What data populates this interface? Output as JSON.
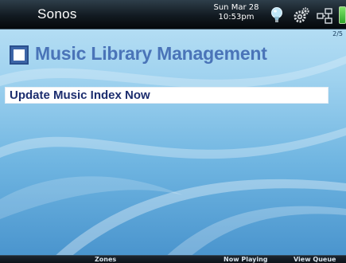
{
  "status_bar": {
    "brand": "Sonos",
    "date": "Sun Mar 28",
    "time": "10:53pm"
  },
  "page_indicator": "2/5",
  "header": {
    "title": "Music Library Management",
    "icon": "checkbox-icon"
  },
  "menu": {
    "items": [
      {
        "label": "Update Music Index Now"
      }
    ]
  },
  "softkeys": {
    "left": "Zones",
    "center": "Now Playing",
    "right": "View Queue"
  },
  "status_icons": [
    "lightbulb-icon",
    "gear-icon",
    "network-icon",
    "battery-icon"
  ],
  "colors": {
    "background_top": "#bfe3f6",
    "background_bottom": "#4792cc",
    "title": "#4a74b8",
    "item_text": "#1c2d6e",
    "battery": "#2fa82a"
  }
}
